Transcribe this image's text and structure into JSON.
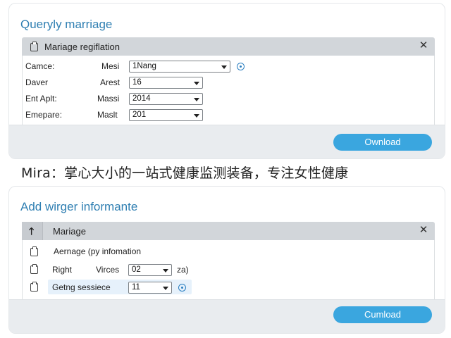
{
  "top_dialog": {
    "title": "Queryly marriage",
    "panel_title": "Mariage regiflation",
    "rows": [
      {
        "label": "Camce:",
        "field_label": "Mesi",
        "value": "1Nang"
      },
      {
        "label": "Daver",
        "field_label": "Arest",
        "value": "16"
      },
      {
        "label": "Ent Aplt:",
        "field_label": "Massi",
        "value": "2014"
      },
      {
        "label": "Emepare:",
        "field_label": "Maslt",
        "value": "201"
      }
    ],
    "button_label": "Ownload"
  },
  "caption": "Mira：掌心大小的一站式健康监测装备，专注女性健康",
  "bottom_dialog": {
    "title": "Add wirger informante",
    "panel_title": "Mariage",
    "rows": [
      {
        "label": "Aernage (py infomation"
      },
      {
        "label": "Right",
        "field_label": "Virces",
        "value": "02",
        "suffix": "za)"
      },
      {
        "label": "Getng sessiece",
        "value": "11"
      }
    ],
    "button_label": "Cumload"
  },
  "colors": {
    "accent": "#3aa6df",
    "title": "#2f7fb2",
    "panel_header": "#d2d6da",
    "footer": "#e9ecef"
  }
}
